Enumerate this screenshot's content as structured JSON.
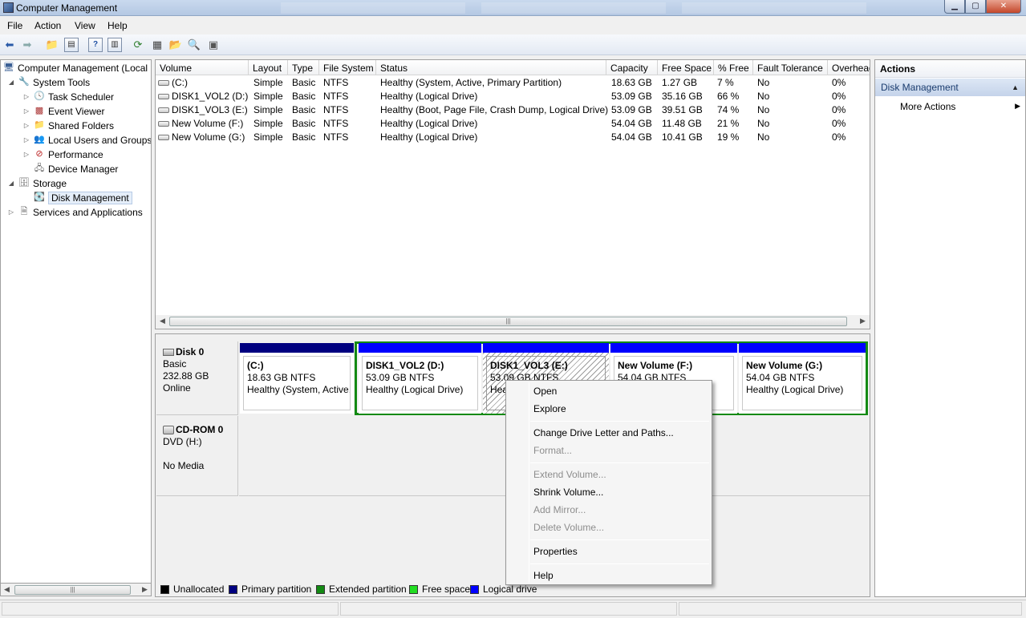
{
  "window": {
    "title": "Computer Management"
  },
  "menu": [
    "File",
    "Action",
    "View",
    "Help"
  ],
  "tree": {
    "root": "Computer Management (Local",
    "system_tools": "System Tools",
    "task_scheduler": "Task Scheduler",
    "event_viewer": "Event Viewer",
    "shared_folders": "Shared Folders",
    "local_users": "Local Users and Groups",
    "performance": "Performance",
    "device_manager": "Device Manager",
    "storage": "Storage",
    "disk_management": "Disk Management",
    "services": "Services and Applications"
  },
  "volumes": {
    "headers": [
      "Volume",
      "Layout",
      "Type",
      "File System",
      "Status",
      "Capacity",
      "Free Space",
      "% Free",
      "Fault Tolerance",
      "Overhead"
    ],
    "rows": [
      [
        "(C:)",
        "Simple",
        "Basic",
        "NTFS",
        "Healthy (System, Active, Primary Partition)",
        "18.63 GB",
        "1.27 GB",
        "7 %",
        "No",
        "0%"
      ],
      [
        "DISK1_VOL2 (D:)",
        "Simple",
        "Basic",
        "NTFS",
        "Healthy (Logical Drive)",
        "53.09 GB",
        "35.16 GB",
        "66 %",
        "No",
        "0%"
      ],
      [
        "DISK1_VOL3 (E:)",
        "Simple",
        "Basic",
        "NTFS",
        "Healthy (Boot, Page File, Crash Dump, Logical Drive)",
        "53.09 GB",
        "39.51 GB",
        "74 %",
        "No",
        "0%"
      ],
      [
        "New Volume (F:)",
        "Simple",
        "Basic",
        "NTFS",
        "Healthy (Logical Drive)",
        "54.04 GB",
        "11.48 GB",
        "21 %",
        "No",
        "0%"
      ],
      [
        "New Volume (G:)",
        "Simple",
        "Basic",
        "NTFS",
        "Healthy (Logical Drive)",
        "54.04 GB",
        "10.41 GB",
        "19 %",
        "No",
        "0%"
      ]
    ]
  },
  "disk0": {
    "name": "Disk 0",
    "type": "Basic",
    "size": "232.88 GB",
    "state": "Online",
    "partitions": [
      {
        "name": "(C:)",
        "size": "18.63 GB NTFS",
        "status": "Healthy (System, Active,",
        "bar": "#000080"
      },
      {
        "name": "DISK1_VOL2  (D:)",
        "size": "53.09 GB NTFS",
        "status": "Healthy (Logical Drive)",
        "bar": "#0000ff"
      },
      {
        "name": "DISK1_VOL3  (E:)",
        "size": "53.09 GB NTFS",
        "status": "Hea",
        "bar": "#0000ff"
      },
      {
        "name": "New Volume  (F:)",
        "size": "54.04 GB NTFS",
        "status": "",
        "bar": "#0000ff"
      },
      {
        "name": "New Volume  (G:)",
        "size": "54.04 GB NTFS",
        "status": "Healthy (Logical Drive)",
        "bar": "#0000ff"
      }
    ]
  },
  "cdrom": {
    "name": "CD-ROM 0",
    "type": "DVD (H:)",
    "state": "No Media"
  },
  "legend": [
    {
      "label": "Unallocated",
      "color": "#000000"
    },
    {
      "label": "Primary partition",
      "color": "#000080"
    },
    {
      "label": "Extended partition",
      "color": "#138a13"
    },
    {
      "label": "Free space",
      "color": "#22dd22"
    },
    {
      "label": "Logical drive",
      "color": "#0000ff"
    }
  ],
  "actions": {
    "header": "Actions",
    "section": "Disk Management",
    "more": "More Actions"
  },
  "context_menu": {
    "open": "Open",
    "explore": "Explore",
    "change_letter": "Change Drive Letter and Paths...",
    "format": "Format...",
    "extend": "Extend Volume...",
    "shrink": "Shrink Volume...",
    "add_mirror": "Add Mirror...",
    "delete": "Delete Volume...",
    "properties": "Properties",
    "help": "Help"
  }
}
